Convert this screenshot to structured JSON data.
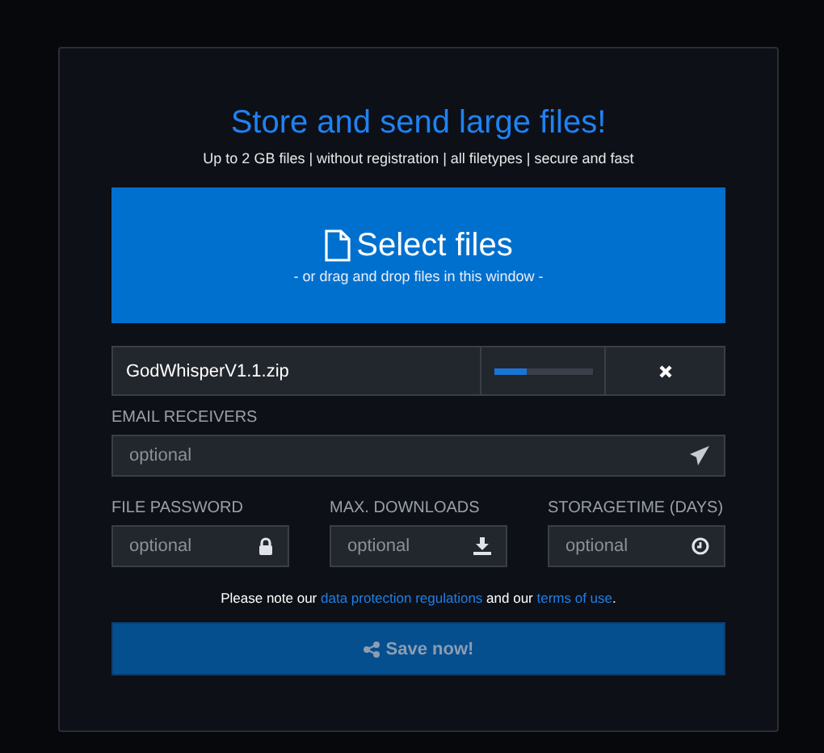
{
  "title": "Store and send large files!",
  "subtitle": "Up to 2 GB files | without registration | all filetypes | secure and fast",
  "dropzone": {
    "label": "Select files",
    "hint": "- or drag and drop files in this window -"
  },
  "upload": {
    "filename": "GodWhisperV1.1.zip",
    "level": 0.34
  },
  "email": {
    "label": "EMAIL RECEIVERS",
    "placeholder": "optional",
    "kind": "send"
  },
  "options": [
    {
      "label": "FILE PASSWORD",
      "placeholder": "optional",
      "kind": "lock"
    },
    {
      "label": "MAX. DOWNLOADS",
      "placeholder": "optional",
      "kind": "download"
    },
    {
      "label": "STORAGETIME (DAYS)",
      "placeholder": "optional",
      "kind": "clock"
    }
  ],
  "note": [
    {
      "kind": "text",
      "text": "Please note our "
    },
    {
      "kind": "link",
      "text": "data protection regulations"
    },
    {
      "kind": "text",
      "text": " and our "
    },
    {
      "kind": "link",
      "text": "terms of use"
    },
    {
      "kind": "text",
      "text": "."
    }
  ],
  "save_button": {
    "label": "Save now!",
    "disabled": true
  }
}
